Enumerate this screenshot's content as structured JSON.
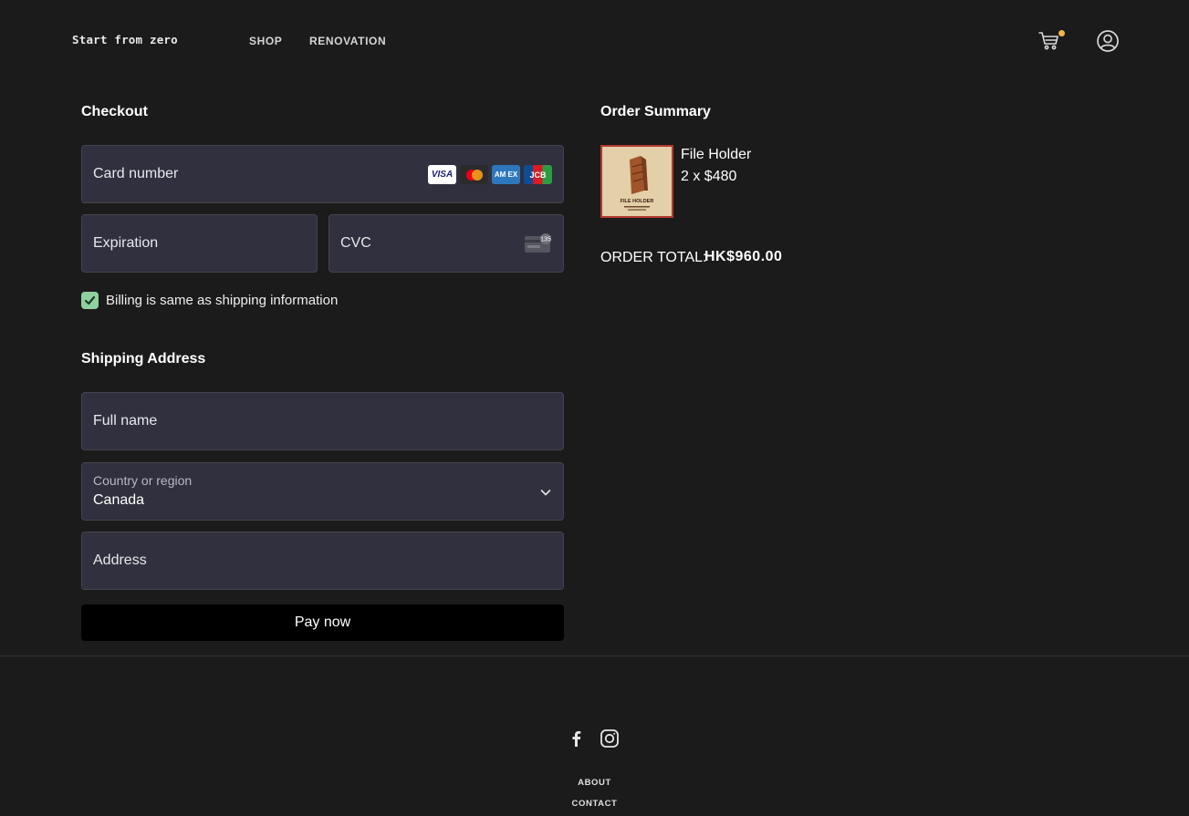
{
  "header": {
    "logo": "Start from zero",
    "nav": [
      {
        "label": "SHOP"
      },
      {
        "label": "RENOVATION"
      }
    ],
    "cart_icon": "cart-icon",
    "user_icon": "user-circle-icon",
    "cart_dot_color": "#f0b84a"
  },
  "checkout": {
    "title": "Checkout",
    "card_number_placeholder": "Card number",
    "card_brands": [
      "VISA",
      "Mastercard",
      "AMEX",
      "JCB"
    ],
    "card_brand_labels": {
      "visa": "VISA",
      "amex": "AM EX",
      "jcb": "JCB"
    },
    "expiration_placeholder": "Expiration",
    "cvc_placeholder": "CVC",
    "cvc_icon_text": "135",
    "billing_checkbox_label": "Billing is same as shipping information",
    "billing_checked": true
  },
  "shipping": {
    "title": "Shipping Address",
    "full_name_placeholder": "Full name",
    "country_label": "Country or region",
    "country_value": "Canada",
    "address_placeholder": "Address"
  },
  "pay_button_label": "Pay now",
  "summary": {
    "title": "Order Summary",
    "items": [
      {
        "name": "File Holder",
        "quantity_price": "2 x $480",
        "thumb_text": "FILE HOLDER"
      }
    ],
    "total_label": "ORDER TOTAL:",
    "total_value": "HK$960.00"
  },
  "footer": {
    "social": [
      "facebook-icon",
      "instagram-icon"
    ],
    "links": [
      "ABOUT",
      "CONTACT"
    ]
  },
  "colors": {
    "background": "#1b1b1c",
    "field_bg": "#30303e",
    "checkbox": "#8fd19e",
    "pay_button": "#000000"
  }
}
